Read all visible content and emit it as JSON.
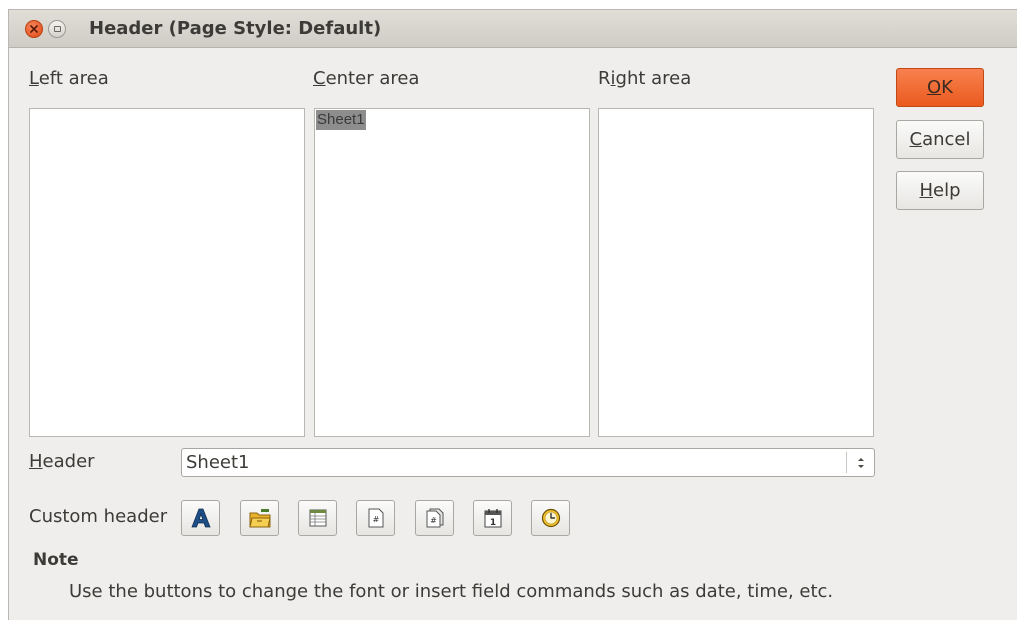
{
  "window": {
    "title": "Header (Page Style: Default)"
  },
  "areas": {
    "left_label_key": "L",
    "left_label_rest": "eft area",
    "center_label_key": "C",
    "center_label_rest": "enter area",
    "center_content": "Sheet1",
    "right_label_pre": "R",
    "right_label_key": "i",
    "right_label_rest": "ght area"
  },
  "buttons": {
    "ok_key": "O",
    "ok_rest": "K",
    "cancel_key": "C",
    "cancel_rest": "ancel",
    "help_key": "H",
    "help_rest": "elp"
  },
  "header_select": {
    "label_key": "H",
    "label_rest": "eader",
    "value": "Sheet1"
  },
  "custom_header": {
    "label": "Custom header",
    "tools": [
      "text-attributes-icon",
      "title-icon",
      "sheet-name-icon",
      "page-icon",
      "pages-icon",
      "date-icon",
      "time-icon"
    ]
  },
  "note": {
    "heading": "Note",
    "text": "Use the buttons to change the font or insert field commands such as date, time, etc."
  },
  "colors": {
    "dialog_bg": "#efeeed",
    "accent_ok": "#ea5a1e",
    "selection": "#8d8d8d"
  }
}
